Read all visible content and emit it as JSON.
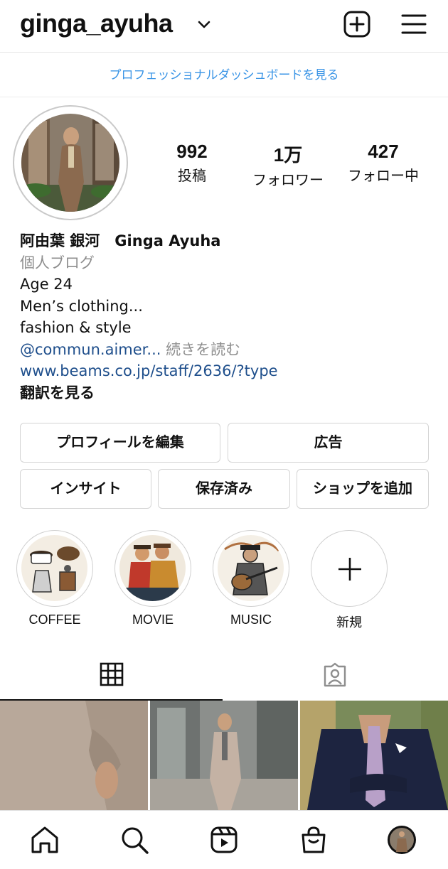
{
  "header": {
    "username": "ginga_ayuha",
    "dashboard_link": "プロフェッショナルダッシュボードを見る"
  },
  "stats": [
    {
      "value": "992",
      "label": "投稿"
    },
    {
      "value": "1万",
      "label": "フォロワー"
    },
    {
      "value": "427",
      "label": "フォロー中"
    }
  ],
  "bio": {
    "name": "阿由葉 銀河　Ginga Ayuha",
    "category": "個人ブログ",
    "line1": "Age 24",
    "line2": "Men’s clothing...",
    "line3": "fashion & style",
    "mention": "@commun.aimer...",
    "more": " 続きを読む",
    "link": "www.beams.co.jp/staff/2636/?type",
    "translate": "翻訳を見る"
  },
  "buttons": {
    "edit_profile": "プロフィールを編集",
    "ads": "広告",
    "insights": "インサイト",
    "saved": "保存済み",
    "add_shop": "ショップを追加"
  },
  "highlights": [
    {
      "label": "COFFEE"
    },
    {
      "label": "MOVIE"
    },
    {
      "label": "MUSIC"
    },
    {
      "label": "新規"
    }
  ],
  "icons": {
    "header": [
      "chevron-down-icon",
      "new-post-icon",
      "menu-icon"
    ],
    "tabs": [
      "grid-icon",
      "tagged-icon"
    ],
    "bottom_nav": [
      "home-icon",
      "search-icon",
      "reels-icon",
      "shop-icon",
      "profile-avatar"
    ]
  },
  "colors": {
    "link_blue": "#3b95e6",
    "bio_link": "#1f4f8c",
    "secondary_text": "#8e8e8e"
  }
}
